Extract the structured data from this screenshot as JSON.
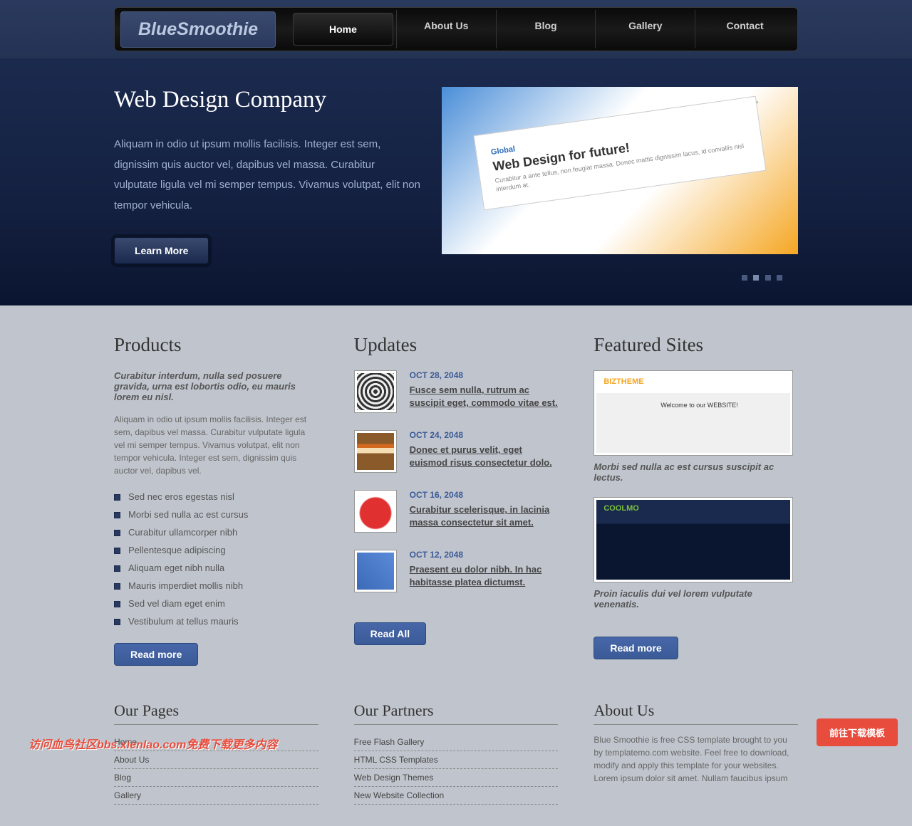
{
  "logo": "BlueSmoothie",
  "nav": [
    "Home",
    "About Us",
    "Blog",
    "Gallery",
    "Contact"
  ],
  "hero": {
    "title": "Web Design Company",
    "text": "Aliquam in odio ut ipsum mollis facilisis. Integer est sem, dignissim quis auctor vel, dapibus vel massa. Curabitur vulputate ligula vel mi semper tempus. Vivamus volutpat, elit non tempor vehicula.",
    "btn": "Learn More",
    "img_text1": "Global",
    "img_text2": "Web Design for future!",
    "img_text3": "Curabitur a ante tellus, non feugiat massa. Donec mattis dignissim lacus, id convallis nisl interdum at."
  },
  "products": {
    "heading": "Products",
    "intro": "Curabitur interdum, nulla sed posuere gravida, urna est lobortis odio, eu mauris lorem eu nisl.",
    "body": "Aliquam in odio ut ipsum mollis facilisis. Integer est sem, dapibus vel massa. Curabitur vulputate ligula vel mi semper tempus. Vivamus volutpat, elit non tempor vehicula. Integer est sem, dignissim quis auctor vel, dapibus vel.",
    "bullets": [
      "Sed nec eros egestas nisl",
      "Morbi sed nulla ac est cursus",
      "Curabitur ullamcorper nibh",
      "Pellentesque adipiscing",
      "Aliquam eget nibh nulla",
      "Mauris imperdiet mollis nibh",
      "Sed vel diam eget enim",
      "Vestibulum at tellus mauris"
    ],
    "btn": "Read more"
  },
  "updates": {
    "heading": "Updates",
    "items": [
      {
        "date": "OCT 28, 2048",
        "text": "Fusce sem nulla, rutrum ac suscipit eget, commodo vitae est.",
        "thumb_bg": "repeating-radial-gradient(circle, #333 0 3px, #eee 3px 6px)"
      },
      {
        "date": "OCT 24, 2048",
        "text": "Donec et purus velit, eget euismod risus consectetur dolo.",
        "thumb_bg": "linear-gradient(#8b5a2b 30%, #d2691e 30% 40%, #f5deb3 40% 55%, #8b5a2b 55%)"
      },
      {
        "date": "OCT 16, 2048",
        "text": "Curabitur scelerisque, in lacinia massa consectetur sit amet.",
        "thumb_bg": "radial-gradient(circle at 50% 55%, #e03030 55%, #fff 60%)"
      },
      {
        "date": "OCT 12, 2048",
        "text": "Praesent eu dolor nibh. In hac habitasse platea dictumst.",
        "thumb_bg": "linear-gradient(45deg, #3a6ab8, #5a8ad8)"
      }
    ],
    "btn": "Read All"
  },
  "featured": {
    "heading": "Featured Sites",
    "items": [
      {
        "caption": "Morbi sed nulla ac est cursus suscipit ac lectus.",
        "bg": "linear-gradient(#fff 25%, #f0f0f0 25% 100%)",
        "overlay_title": "BIZTHEME",
        "overlay_sub": "Welcome to our WEBSITE!",
        "overlay_color": "#f5a623"
      },
      {
        "caption": "Proin iaculis dui vel lorem vulputate venenatis.",
        "bg": "linear-gradient(#1a2a4e 30%, #0a1530 30%)",
        "overlay_title": "COOLMO",
        "overlay_sub": "",
        "overlay_color": "#7ac040"
      }
    ],
    "btn": "Read more"
  },
  "footer": {
    "pages": {
      "heading": "Our Pages",
      "links": [
        "Home",
        "About Us",
        "Blog",
        "Gallery"
      ]
    },
    "partners": {
      "heading": "Our Partners",
      "links": [
        "Free Flash Gallery",
        "HTML CSS Templates",
        "Web Design Themes",
        "New Website Collection"
      ]
    },
    "about": {
      "heading": "About Us",
      "text": "Blue Smoothie is free CSS template brought to you by templatemo.com website. Feel free to download, modify and apply this template for your websites. Lorem ipsum dolor sit amet. Nullam faucibus ipsum"
    }
  },
  "dl_btn": "前往下载模板",
  "watermark": "访问血鸟社区bbs.xienlao.com免费下载更多内容"
}
